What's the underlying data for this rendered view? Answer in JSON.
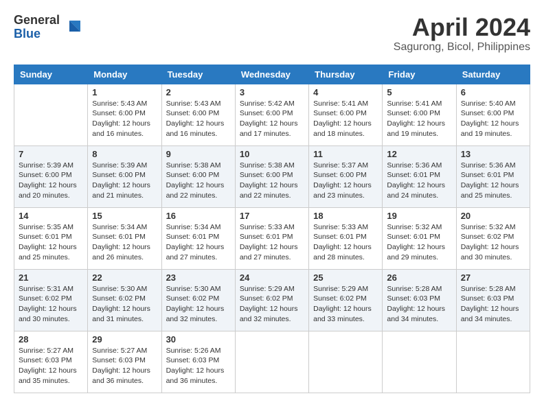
{
  "header": {
    "logo_general": "General",
    "logo_blue": "Blue",
    "month_title": "April 2024",
    "location": "Sagurong, Bicol, Philippines"
  },
  "calendar": {
    "days_of_week": [
      "Sunday",
      "Monday",
      "Tuesday",
      "Wednesday",
      "Thursday",
      "Friday",
      "Saturday"
    ],
    "weeks": [
      [
        {
          "day": "",
          "empty": true
        },
        {
          "day": "1",
          "sunrise": "5:43 AM",
          "sunset": "6:00 PM",
          "daylight": "12 hours and 16 minutes."
        },
        {
          "day": "2",
          "sunrise": "5:43 AM",
          "sunset": "6:00 PM",
          "daylight": "12 hours and 16 minutes."
        },
        {
          "day": "3",
          "sunrise": "5:42 AM",
          "sunset": "6:00 PM",
          "daylight": "12 hours and 17 minutes."
        },
        {
          "day": "4",
          "sunrise": "5:41 AM",
          "sunset": "6:00 PM",
          "daylight": "12 hours and 18 minutes."
        },
        {
          "day": "5",
          "sunrise": "5:41 AM",
          "sunset": "6:00 PM",
          "daylight": "12 hours and 19 minutes."
        },
        {
          "day": "6",
          "sunrise": "5:40 AM",
          "sunset": "6:00 PM",
          "daylight": "12 hours and 19 minutes."
        }
      ],
      [
        {
          "day": "7",
          "sunrise": "5:39 AM",
          "sunset": "6:00 PM",
          "daylight": "12 hours and 20 minutes."
        },
        {
          "day": "8",
          "sunrise": "5:39 AM",
          "sunset": "6:00 PM",
          "daylight": "12 hours and 21 minutes."
        },
        {
          "day": "9",
          "sunrise": "5:38 AM",
          "sunset": "6:00 PM",
          "daylight": "12 hours and 22 minutes."
        },
        {
          "day": "10",
          "sunrise": "5:38 AM",
          "sunset": "6:00 PM",
          "daylight": "12 hours and 22 minutes."
        },
        {
          "day": "11",
          "sunrise": "5:37 AM",
          "sunset": "6:00 PM",
          "daylight": "12 hours and 23 minutes."
        },
        {
          "day": "12",
          "sunrise": "5:36 AM",
          "sunset": "6:01 PM",
          "daylight": "12 hours and 24 minutes."
        },
        {
          "day": "13",
          "sunrise": "5:36 AM",
          "sunset": "6:01 PM",
          "daylight": "12 hours and 25 minutes."
        }
      ],
      [
        {
          "day": "14",
          "sunrise": "5:35 AM",
          "sunset": "6:01 PM",
          "daylight": "12 hours and 25 minutes."
        },
        {
          "day": "15",
          "sunrise": "5:34 AM",
          "sunset": "6:01 PM",
          "daylight": "12 hours and 26 minutes."
        },
        {
          "day": "16",
          "sunrise": "5:34 AM",
          "sunset": "6:01 PM",
          "daylight": "12 hours and 27 minutes."
        },
        {
          "day": "17",
          "sunrise": "5:33 AM",
          "sunset": "6:01 PM",
          "daylight": "12 hours and 27 minutes."
        },
        {
          "day": "18",
          "sunrise": "5:33 AM",
          "sunset": "6:01 PM",
          "daylight": "12 hours and 28 minutes."
        },
        {
          "day": "19",
          "sunrise": "5:32 AM",
          "sunset": "6:01 PM",
          "daylight": "12 hours and 29 minutes."
        },
        {
          "day": "20",
          "sunrise": "5:32 AM",
          "sunset": "6:02 PM",
          "daylight": "12 hours and 30 minutes."
        }
      ],
      [
        {
          "day": "21",
          "sunrise": "5:31 AM",
          "sunset": "6:02 PM",
          "daylight": "12 hours and 30 minutes."
        },
        {
          "day": "22",
          "sunrise": "5:30 AM",
          "sunset": "6:02 PM",
          "daylight": "12 hours and 31 minutes."
        },
        {
          "day": "23",
          "sunrise": "5:30 AM",
          "sunset": "6:02 PM",
          "daylight": "12 hours and 32 minutes."
        },
        {
          "day": "24",
          "sunrise": "5:29 AM",
          "sunset": "6:02 PM",
          "daylight": "12 hours and 32 minutes."
        },
        {
          "day": "25",
          "sunrise": "5:29 AM",
          "sunset": "6:02 PM",
          "daylight": "12 hours and 33 minutes."
        },
        {
          "day": "26",
          "sunrise": "5:28 AM",
          "sunset": "6:03 PM",
          "daylight": "12 hours and 34 minutes."
        },
        {
          "day": "27",
          "sunrise": "5:28 AM",
          "sunset": "6:03 PM",
          "daylight": "12 hours and 34 minutes."
        }
      ],
      [
        {
          "day": "28",
          "sunrise": "5:27 AM",
          "sunset": "6:03 PM",
          "daylight": "12 hours and 35 minutes."
        },
        {
          "day": "29",
          "sunrise": "5:27 AM",
          "sunset": "6:03 PM",
          "daylight": "12 hours and 36 minutes."
        },
        {
          "day": "30",
          "sunrise": "5:26 AM",
          "sunset": "6:03 PM",
          "daylight": "12 hours and 36 minutes."
        },
        {
          "day": "",
          "empty": true
        },
        {
          "day": "",
          "empty": true
        },
        {
          "day": "",
          "empty": true
        },
        {
          "day": "",
          "empty": true
        }
      ]
    ],
    "labels": {
      "sunrise": "Sunrise:",
      "sunset": "Sunset:",
      "daylight": "Daylight:"
    }
  }
}
